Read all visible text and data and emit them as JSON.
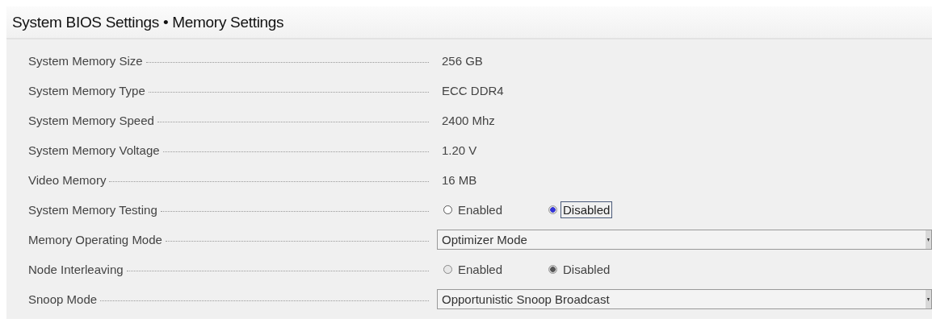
{
  "title": "System BIOS Settings • Memory Settings",
  "rows": [
    {
      "kind": "text",
      "label": "System Memory Size",
      "value": "256 GB"
    },
    {
      "kind": "text",
      "label": "System Memory Type",
      "value": "ECC DDR4"
    },
    {
      "kind": "text",
      "label": "System Memory Speed",
      "value": "2400 Mhz"
    },
    {
      "kind": "text",
      "label": "System Memory Voltage",
      "value": "1.20 V"
    },
    {
      "kind": "text",
      "label": "Video Memory",
      "value": "16 MB"
    },
    {
      "kind": "radio",
      "label": "System Memory Testing",
      "disabled": false,
      "options": [
        {
          "label": "Enabled",
          "selected": false,
          "focused": false
        },
        {
          "label": "Disabled",
          "selected": true,
          "focused": true
        }
      ]
    },
    {
      "kind": "dropdown",
      "label": "Memory Operating Mode",
      "value": "Optimizer Mode"
    },
    {
      "kind": "radio",
      "label": "Node Interleaving",
      "disabled": true,
      "options": [
        {
          "label": "Enabled",
          "selected": false,
          "focused": false
        },
        {
          "label": "Disabled",
          "selected": true,
          "focused": false
        }
      ]
    },
    {
      "kind": "dropdown",
      "label": "Snoop Mode",
      "value": "Opportunistic Snoop Broadcast"
    }
  ]
}
